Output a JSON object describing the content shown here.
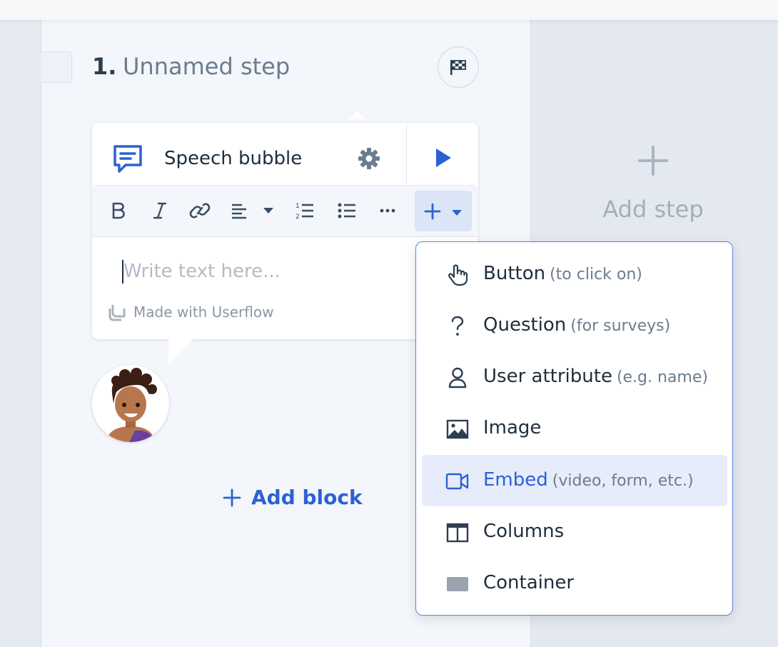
{
  "step": {
    "number": "1.",
    "title": "Unnamed step"
  },
  "add_step": {
    "label": "Add step"
  },
  "block": {
    "title": "Speech bubble",
    "placeholder": "Write text here...",
    "branding": "Made with Userflow"
  },
  "add_block": {
    "label": "Add block"
  },
  "toolbar": {
    "icons": [
      "bold-icon",
      "italic-icon",
      "link-icon",
      "align-left-icon",
      "chevron-down-icon",
      "ordered-list-icon",
      "bullet-list-icon",
      "more-icon",
      "plus-icon"
    ]
  },
  "insert_menu": {
    "items": [
      {
        "label": "Button",
        "hint": "(to click on)",
        "icon": "pointer-hand-icon"
      },
      {
        "label": "Question",
        "hint": "(for surveys)",
        "icon": "question-icon"
      },
      {
        "label": "User attribute",
        "hint": "(e.g. name)",
        "icon": "user-icon"
      },
      {
        "label": "Image",
        "hint": "",
        "icon": "image-icon"
      },
      {
        "label": "Embed",
        "hint": "(video, form, etc.)",
        "icon": "video-icon"
      },
      {
        "label": "Columns",
        "hint": "",
        "icon": "columns-icon"
      },
      {
        "label": "Container",
        "hint": "",
        "icon": "container-icon"
      }
    ],
    "active_item": "Embed"
  },
  "colors": {
    "accent": "#2c61d6",
    "active_bg": "#e7ecfb",
    "text": "#1f2d3d",
    "muted": "#6b7c8f"
  }
}
